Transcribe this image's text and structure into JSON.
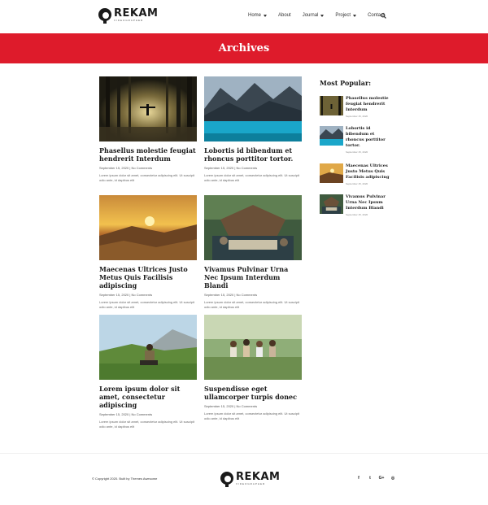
{
  "brand": {
    "name": "REKAM",
    "tagline": "VIDEOGRAPHER"
  },
  "nav": {
    "items": [
      {
        "label": "Home",
        "has_dropdown": true
      },
      {
        "label": "About",
        "has_dropdown": false
      },
      {
        "label": "Journal",
        "has_dropdown": true
      },
      {
        "label": "Project",
        "has_dropdown": true
      },
      {
        "label": "Contact",
        "has_dropdown": false
      }
    ],
    "search_icon": "search-icon"
  },
  "banner": {
    "title": "Archives",
    "color": "#de1b2b"
  },
  "posts": [
    {
      "title": "Phasellus molestie feugiat hendrerit Interdum",
      "date": "September 15, 2020",
      "comments": "No Comments",
      "excerpt": "Lorem ipsum dolor sit amet, consectetur adipiscing elit. Ut suscipit odio ante, id dapibus elit"
    },
    {
      "title": "Lobortis id bibendum et rhoncus porttitor tortor.",
      "date": "September 15, 2020",
      "comments": "No Comments",
      "excerpt": "Lorem ipsum dolor sit amet, consectetur adipiscing elit. Ut suscipit odio ante, id dapibus elit"
    },
    {
      "title": "Maecenas Ultrices Justo Metus Quis Facilisis adipiscing",
      "date": "September 15, 2020",
      "comments": "No Comments",
      "excerpt": "Lorem ipsum dolor sit amet, consectetur adipiscing elit. Ut suscipit odio ante, id dapibus elit"
    },
    {
      "title": "Vivamus Pulvinar Urna Nec Ipsum Interdum Blandi",
      "date": "September 15, 2020",
      "comments": "No Comments",
      "excerpt": "Lorem ipsum dolor sit amet, consectetur adipiscing elit. Ut suscipit odio ante, id dapibus elit"
    },
    {
      "title": "Lorem ipsum dolor sit amet, consectetur adipiscing",
      "date": "September 15, 2020",
      "comments": "No Comments",
      "excerpt": "Lorem ipsum dolor sit amet, consectetur adipiscing elit. Ut suscipit odio ante, id dapibus elit"
    },
    {
      "title": "Suspendisse eget ullamcorper turpis donec",
      "date": "September 15, 2020",
      "comments": "No Comments",
      "excerpt": "Lorem ipsum dolor sit amet, consectetur adipiscing elit. Ut suscipit odio ante, id dapibus elit"
    }
  ],
  "sidebar": {
    "title": "Most Popular:",
    "items": [
      {
        "title": "Phasellus molestie feugiat hendrerit Interdum",
        "date": "September 15, 2020"
      },
      {
        "title": "Lobortis id bibendum et rhoncus porttitor tortor.",
        "date": "September 15, 2020"
      },
      {
        "title": "Maecenas Ultrices Justo Metus Quis Facilisis adipiscing",
        "date": "September 15, 2020"
      },
      {
        "title": "Vivamus Pulvinar Urna Nec Ipsum Interdum Blandi",
        "date": "September 15, 2020"
      }
    ]
  },
  "footer": {
    "copyright": "© Copyright 2020. Built by Themes Awesome",
    "social": [
      {
        "icon": "facebook-icon",
        "glyph": "f"
      },
      {
        "icon": "twitter-icon",
        "glyph": "t"
      },
      {
        "icon": "google-plus-icon",
        "glyph": "G+"
      },
      {
        "icon": "dribbble-icon",
        "glyph": "◎"
      }
    ]
  }
}
